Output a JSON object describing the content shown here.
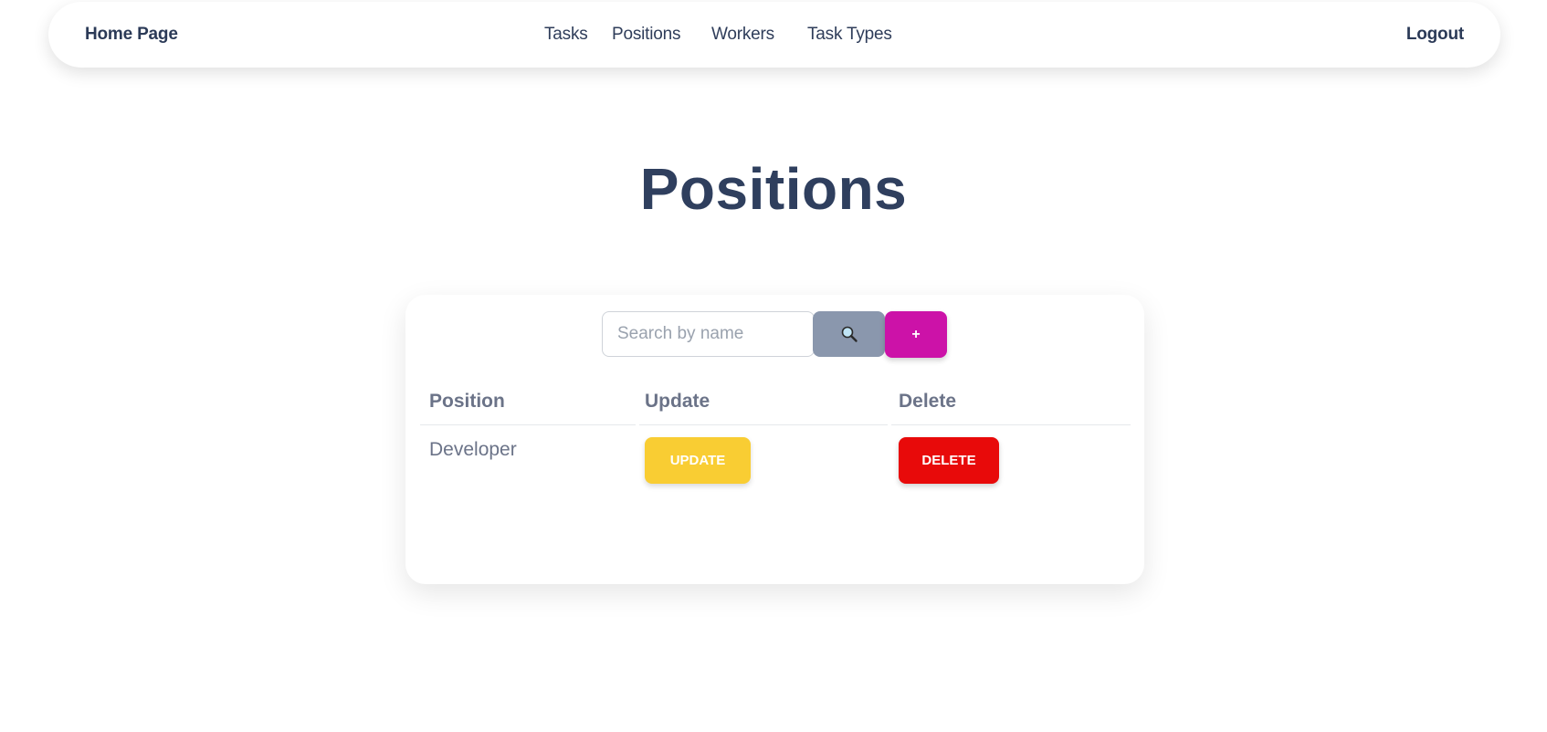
{
  "nav": {
    "home": "Home Page",
    "links": [
      "Tasks",
      "Positions",
      "Workers",
      "Task Types"
    ],
    "logout": "Logout"
  },
  "page": {
    "title": "Positions"
  },
  "toolbar": {
    "search_placeholder": "Search by name",
    "search_value": "",
    "search_icon": "magnifier-icon",
    "add_label": "+"
  },
  "table": {
    "headers": [
      "Position",
      "Update",
      "Delete"
    ],
    "rows": [
      {
        "position": "Developer",
        "update_label": "UPDATE",
        "delete_label": "DELETE"
      }
    ]
  },
  "colors": {
    "text_primary": "#2f3f5e",
    "text_muted": "#6b7388",
    "search_button": "#8a97ad",
    "add_button": "#cc12a8",
    "update_button": "#f9cd33",
    "delete_button": "#e80a0a"
  }
}
